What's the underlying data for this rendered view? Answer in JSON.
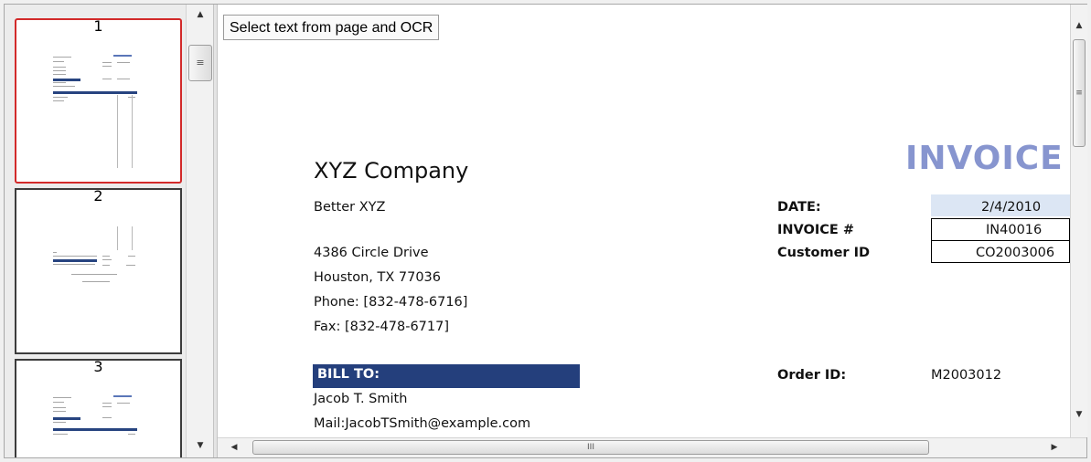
{
  "thumbnails": [
    {
      "number": "1",
      "selected": true
    },
    {
      "number": "2",
      "selected": false
    },
    {
      "number": "3",
      "selected": false
    }
  ],
  "toolbar": {
    "ocr_button_label": "Select text from page and OCR"
  },
  "scrollbars": {
    "up_icon": "▲",
    "down_icon": "▼",
    "left_icon": "◀",
    "right_icon": "▶",
    "grip_icon": "≡",
    "hgrip_icon": "III"
  },
  "document": {
    "company_name": "XYZ Company",
    "tagline": "Better XYZ",
    "address_line1": "4386 Circle Drive",
    "address_line2": "Houston, TX 77036",
    "phone": "Phone: [832-478-6716]",
    "fax": "Fax: [832-478-6717]",
    "title": "INVOICE",
    "date_label": "DATE:",
    "date_value": "2/4/2010",
    "invoice_label": "INVOICE #",
    "invoice_value": "IN40016",
    "customer_label": "Customer ID",
    "customer_value": "CO2003006",
    "bill_to_label": "BILL TO:",
    "bill_to_name": "Jacob T. Smith",
    "bill_to_mail": "Mail:JacobTSmith@example.com",
    "order_label": "Order ID:",
    "order_value": "M2003012"
  },
  "colors": {
    "selected_border": "#d22a2a",
    "invoice_title": "#8795cf",
    "bill_to_bar": "#243f7c",
    "date_highlight": "#dce6f4"
  }
}
